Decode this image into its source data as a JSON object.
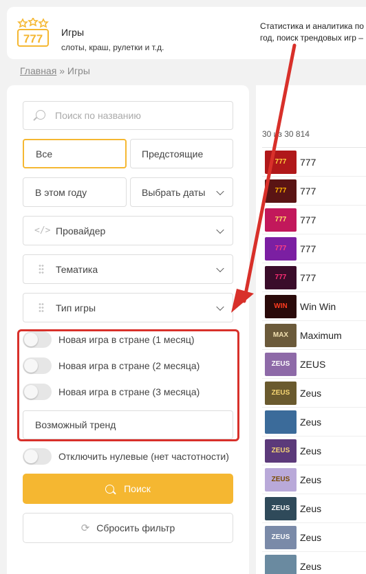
{
  "header": {
    "title": "Игры",
    "subtitle": "слоты, краш, рулетки и т.д.",
    "description": "Статистика и аналитика по\nгод, поиск трендовых игр –",
    "logo_text": "777"
  },
  "breadcrumb": {
    "home": "Главная",
    "separator": "»",
    "current": "Игры"
  },
  "filters": {
    "search_placeholder": "Поиск по названию",
    "all_label": "Все",
    "upcoming_label": "Предстоящие",
    "this_year_label": "В этом году",
    "choose_dates_label": "Выбрать даты",
    "provider_label": "Провайдер",
    "theme_label": "Тематика",
    "game_type_label": "Тип игры",
    "toggles": [
      {
        "label": "Новая игра в стране (1 месяц)",
        "on": false
      },
      {
        "label": "Новая игра в стране (2 месяца)",
        "on": false
      },
      {
        "label": "Новая игра в стране (3 месяца)",
        "on": false
      }
    ],
    "trend_label": "Возможный тренд",
    "zero_toggle_label": "Отключить нулевые (нет частотности)",
    "search_button": "Поиск",
    "reset_button": "Сбросить фильтр"
  },
  "results": {
    "count_text": "30 из 30 814",
    "games": [
      {
        "name": "777",
        "thumb": "777",
        "bg": "#b0181a",
        "fg": "#ffd23f"
      },
      {
        "name": "777",
        "thumb": "777",
        "bg": "#5a1414",
        "fg": "#ffb300"
      },
      {
        "name": "777",
        "thumb": "777",
        "bg": "#c2185b",
        "fg": "#ffe066"
      },
      {
        "name": "777",
        "thumb": "777",
        "bg": "#7b1fa2",
        "fg": "#ff4081"
      },
      {
        "name": "777",
        "thumb": "777",
        "bg": "#3a0c2a",
        "fg": "#ff2d75"
      },
      {
        "name": "Win Win",
        "thumb": "WIN",
        "bg": "#2a0a0a",
        "fg": "#ff3b1f"
      },
      {
        "name": "Maximum",
        "thumb": "MAX",
        "bg": "#6b5a3a",
        "fg": "#f2e0b0"
      },
      {
        "name": "ZEUS",
        "thumb": "ZEUS",
        "bg": "#8e6aa8",
        "fg": "#fff"
      },
      {
        "name": "Zeus",
        "thumb": "ZEUS",
        "bg": "#6a5a2e",
        "fg": "#f7d774"
      },
      {
        "name": "Zeus",
        "thumb": "",
        "bg": "#3b6b9a",
        "fg": "#fff"
      },
      {
        "name": "Zeus",
        "thumb": "ZEUS",
        "bg": "#5c3a7a",
        "fg": "#f7d774"
      },
      {
        "name": "Zeus",
        "thumb": "ZEUS",
        "bg": "#b9a9d9",
        "fg": "#7a4a00"
      },
      {
        "name": "Zeus",
        "thumb": "ZEUS",
        "bg": "#2f4a5a",
        "fg": "#fff"
      },
      {
        "name": "Zeus",
        "thumb": "ZEUS",
        "bg": "#7a8aa8",
        "fg": "#fff"
      },
      {
        "name": "Zeus",
        "thumb": "",
        "bg": "#6a8aa0",
        "fg": "#fff"
      }
    ]
  },
  "colors": {
    "accent": "#f5b731",
    "annotation": "#d8302a"
  }
}
